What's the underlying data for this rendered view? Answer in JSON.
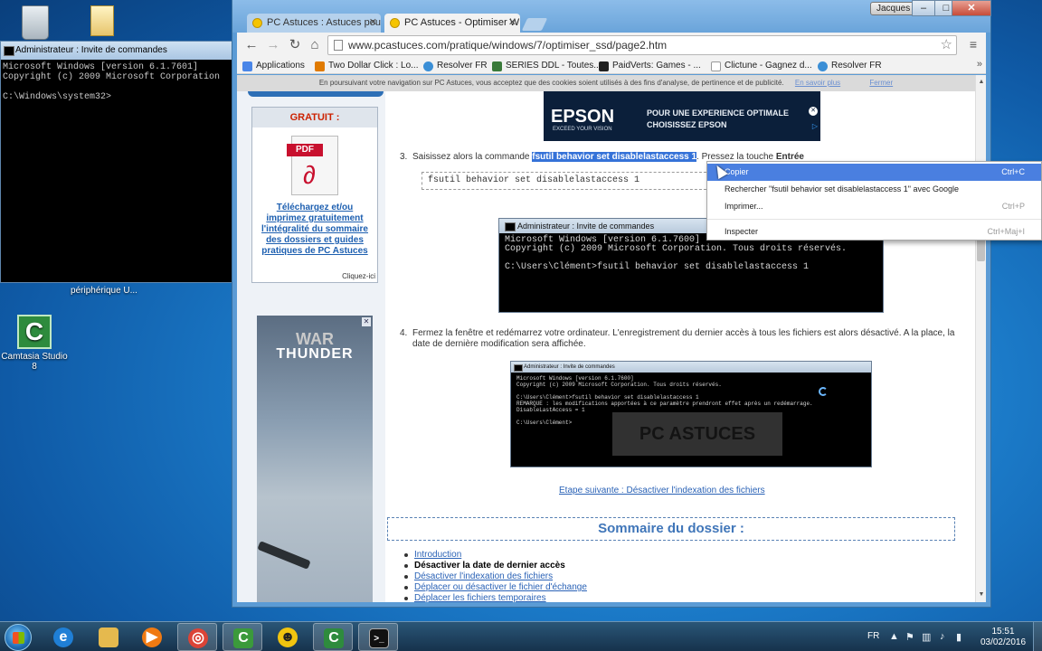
{
  "desktop": {
    "icons": [
      {
        "label": "périphérique U..."
      },
      {
        "label": "Camtasia Studio 8"
      }
    ]
  },
  "cmd_window": {
    "title": "Administrateur : Invite de commandes",
    "lines": "Microsoft Windows [version 6.1.7601]\nCopyright (c) 2009 Microsoft Corporation\n\nC:\\Windows\\system32>"
  },
  "chrome": {
    "tabs": [
      {
        "label": "PC Astuces : Astuces pour",
        "active": false
      },
      {
        "label": "PC Astuces - Optimiser W",
        "active": true
      }
    ],
    "user": "Jacques",
    "window_controls": {
      "minimize": "–",
      "maximize": "□",
      "close": "✕"
    },
    "url": "www.pcastuces.com/pratique/windows/7/optimiser_ssd/page2.htm",
    "bookmarks": [
      {
        "label": "Applications",
        "color": "#4a86e8"
      },
      {
        "label": "Two Dollar Click : Lo...",
        "color": "#e07a00"
      },
      {
        "label": "Resolver FR",
        "color": "#3b8fd6"
      },
      {
        "label": "SERIES DDL - Toutes...",
        "color": "#3a7a3a"
      },
      {
        "label": "PaidVerts: Games - ...",
        "color": "#222222"
      },
      {
        "label": "Clictune - Gagnez d...",
        "color": "#bbbbbb"
      },
      {
        "label": "Resolver FR",
        "color": "#3b8fd6"
      }
    ],
    "bookmarks_more": "»"
  },
  "page": {
    "cookie_text": "En poursuivant votre navigation sur PC Astuces, vous acceptez que des cookies soient utilisés à des fins d'analyse, de pertinence et de publicité.",
    "cookie_more": "En savoir plus",
    "cookie_close": "Fermer",
    "sidebar": {
      "gratuit_title": "GRATUIT :",
      "pdf_label": "PDF",
      "promo_text": "Téléchargez et/ou imprimez gratuitement l'intégralité du sommaire des dossiers et guides pratiques de PC Astuces",
      "cta": "Cliquez-ici",
      "ad_title": "WAR",
      "ad_sub": "THUNDER"
    },
    "epson_ad": {
      "logo": "EPSON",
      "logo_sub": "EXCEED YOUR VISION",
      "tagline_1": "POUR UNE EXPERIENCE OPTIMALE",
      "tagline_2": "CHOISISSEZ EPSON"
    },
    "step3": {
      "num": "3.",
      "before": "Saisissez alors la commande ",
      "highlight": "fsutil behavior set disablelastaccess 1",
      "after": ". Pressez la touche ",
      "key": "Entrée",
      "code": "fsutil behavior set disablelastaccess 1"
    },
    "screenshot1": {
      "title": "Administrateur : Invite de commandes",
      "body": "Microsoft Windows [version 6.1.7600]\nCopyright (c) 2009 Microsoft Corporation. Tous droits réservés.\n\nC:\\Users\\Clément>fsutil behavior set disablelastaccess 1"
    },
    "step4": {
      "num": "4.",
      "text": "Fermez la fenêtre et redémarrez votre ordinateur. L'enregistrement du dernier accès à tous les fichiers est alors désactivé. A la place, la date de dernière modification sera affichée."
    },
    "screenshot2": {
      "title": "Administrateur : Invite de commandes",
      "body": "Microsoft Windows [version 6.1.7600]\nCopyright (c) 2009 Microsoft Corporation. Tous droits réservés.\n\nC:\\Users\\Clément>fsutil behavior set disablelastaccess 1\nREMARQUE : les modifications apportées à ce paramètre prendront effet après un redémarrage.\nDisableLastAccess = 1\n\nC:\\Users\\Clément>",
      "watermark": "PC ASTUCES"
    },
    "next_link": "Etape suivante : Désactiver l'indexation des fichiers",
    "sommaire_title": "Sommaire du dossier :",
    "toc": [
      {
        "label": "Introduction",
        "current": false
      },
      {
        "label": "Désactiver la date de dernier accès",
        "current": true
      },
      {
        "label": "Désactiver l'indexation des fichiers",
        "current": false
      },
      {
        "label": "Déplacer ou désactiver le fichier d'échange",
        "current": false
      },
      {
        "label": "Déplacer les fichiers temporaires",
        "current": false
      }
    ]
  },
  "context_menu": {
    "items": [
      {
        "label": "Copier",
        "shortcut": "Ctrl+C",
        "selected": true
      },
      {
        "label": "Rechercher \"fsutil behavior set disablelastaccess 1\" avec Google",
        "shortcut": "",
        "selected": false
      },
      {
        "label": "Imprimer...",
        "shortcut": "Ctrl+P",
        "selected": false
      },
      {
        "label": "Inspecter",
        "shortcut": "Ctrl+Maj+I",
        "selected": false
      }
    ]
  },
  "taskbar": {
    "apps": [
      {
        "name": "internet-explorer",
        "color": "#1f7fd6",
        "glyph": "e"
      },
      {
        "name": "explorer",
        "color": "#e5b94e",
        "glyph": ""
      },
      {
        "name": "media-player",
        "color": "#f07a12",
        "glyph": "▶"
      },
      {
        "name": "chrome",
        "color": "#db4437",
        "glyph": "◎"
      },
      {
        "name": "camtasia-recorder",
        "color": "#3b9a3b",
        "glyph": "C"
      },
      {
        "name": "app-yellow",
        "color": "#f1c40f",
        "glyph": "☻"
      },
      {
        "name": "camtasia-studio",
        "color": "#2e8b3d",
        "glyph": "C"
      },
      {
        "name": "cmd",
        "color": "#111111",
        "glyph": "▪"
      }
    ],
    "lang": "FR",
    "time": "15:51",
    "date": "03/02/2016"
  }
}
